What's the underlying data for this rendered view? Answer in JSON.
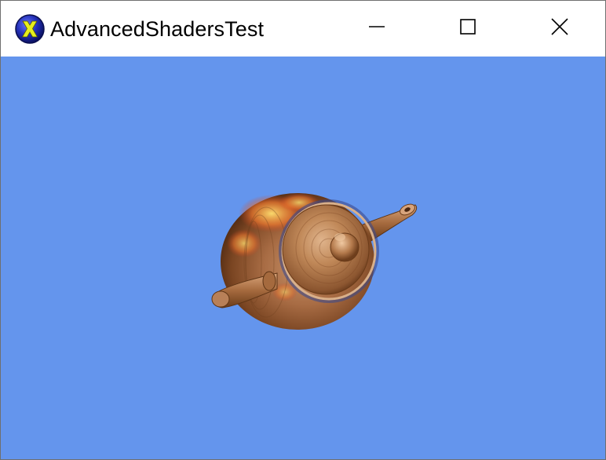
{
  "window": {
    "title": "AdvancedShadersTest",
    "app_icon": "directx-x-icon",
    "controls": {
      "minimize_icon": "minimize-icon",
      "maximize_icon": "maximize-icon",
      "close_icon": "close-icon"
    }
  },
  "viewport": {
    "background_color": "#6495ed",
    "scene_object": "teapot"
  }
}
